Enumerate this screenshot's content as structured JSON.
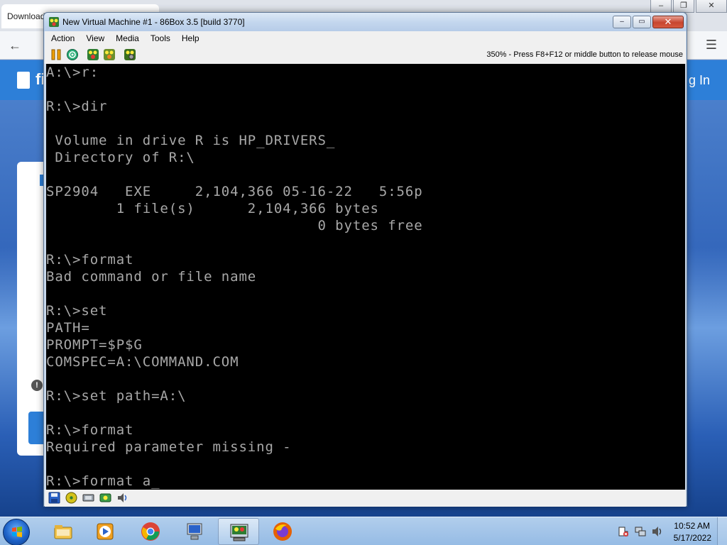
{
  "browser": {
    "tab_title": "Download",
    "logo_text": "fi",
    "signin_text": "g In",
    "warning_glyph": "!",
    "window_buttons": [
      "–",
      "❐",
      "✕"
    ],
    "menu_glyph": "☰",
    "back_glyph": "←"
  },
  "vm": {
    "title": "New Virtual Machine #1 - 86Box 3.5 [build 3770]",
    "caption_buttons": {
      "minimize": "–",
      "maximize": "▭",
      "close": "✕"
    },
    "menu": [
      "Action",
      "View",
      "Media",
      "Tools",
      "Help"
    ],
    "toolbar_status": "350% - Press F8+F12 or middle button to release mouse",
    "toolbar_icons": [
      "pause-icon",
      "hard-reset-icon",
      "ctrl-alt-del-icon",
      "ctrl-alt-esc-icon",
      "settings-icon"
    ],
    "screen_lines": [
      "A:\\>r:",
      "",
      "R:\\>dir",
      "",
      " Volume in drive R is HP_DRIVERS_",
      " Directory of R:\\",
      "",
      "SP2904   EXE     2,104,366 05-16-22   5:56p",
      "        1 file(s)      2,104,366 bytes",
      "                               0 bytes free",
      "",
      "R:\\>format",
      "Bad command or file name",
      "",
      "R:\\>set",
      "PATH=",
      "PROMPT=$P$G",
      "COMSPEC=A:\\COMMAND.COM",
      "",
      "R:\\>set path=A:\\",
      "",
      "R:\\>format",
      "Required parameter missing -",
      "",
      "R:\\>format a_"
    ],
    "status_icons": [
      "floppy-drive-icon",
      "cdrom-drive-icon",
      "network-icon",
      "hard-disk-icon",
      "sound-icon"
    ]
  },
  "taskbar": {
    "apps": [
      "explorer-icon",
      "media-player-icon",
      "chrome-icon",
      "vm-manager-icon",
      "86box-icon",
      "firefox-icon"
    ],
    "active_app_index": 4,
    "clock_time": "10:52 AM",
    "clock_date": "5/17/2022"
  },
  "colors": {
    "dos_text": "#a8a8a8",
    "dos_background": "#000000",
    "titlebar": "#c4d7ee",
    "close_button": "#c7452f",
    "taskbar": "#a0c3e8"
  }
}
